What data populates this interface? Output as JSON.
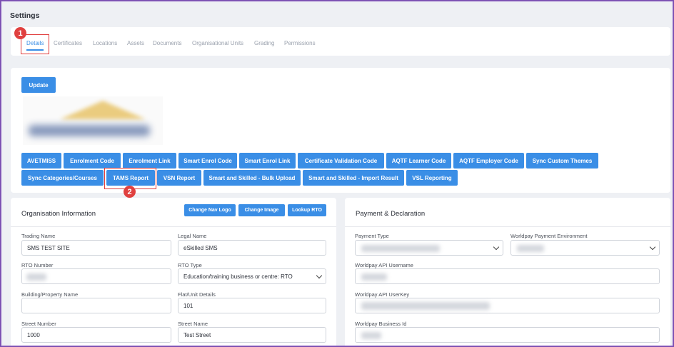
{
  "page": {
    "title": "Settings"
  },
  "tabs": [
    "Details",
    "Certificates",
    "Locations",
    "Assets",
    "Documents",
    "Organisational Units",
    "Grading",
    "Permissions"
  ],
  "callouts": {
    "first": "1",
    "second": "2"
  },
  "update_button": "Update",
  "action_buttons_row1": [
    "AVETMISS",
    "Enrolment Code",
    "Enrolment Link",
    "Smart Enrol Code",
    "Smart Enrol Link",
    "Certificate Validation Code",
    "AQTF Learner Code",
    "AQTF Employer Code",
    "Sync Custom Themes"
  ],
  "action_buttons_row2": [
    "Sync Categories/Courses",
    "TAMS Report",
    "VSN Report",
    "Smart and Skilled - Bulk Upload",
    "Smart and Skilled - Import Result",
    "VSL Reporting"
  ],
  "org_info": {
    "title": "Organisation Information",
    "buttons": [
      "Change Nav Logo",
      "Change Image",
      "Lookup RTO"
    ],
    "fields": {
      "trading_name_label": "Trading Name",
      "trading_name_value": "SMS TEST SITE",
      "legal_name_label": "Legal Name",
      "legal_name_value": "eSkilled SMS",
      "rto_number_label": "RTO Number",
      "rto_type_label": "RTO Type",
      "rto_type_value": "Education/training business or centre: RTO",
      "building_label": "Building/Property Name",
      "flat_label": "Flat/Unit Details",
      "flat_value": "101",
      "street_number_label": "Street Number",
      "street_number_value": "1000",
      "street_name_label": "Street Name",
      "street_name_value": "Test Street"
    }
  },
  "payment": {
    "title": "Payment & Declaration",
    "payment_type_label": "Payment Type",
    "worldpay_env_label": "Worldpay Payment Environment",
    "worldpay_username_label": "Worldpay API Username",
    "worldpay_userkey_label": "Worldpay API UserKey",
    "worldpay_business_label": "Worldpay Business Id"
  },
  "colors": {
    "accent": "#3a8ee6",
    "callout": "#e0403f",
    "frame": "#8a5cc0"
  }
}
